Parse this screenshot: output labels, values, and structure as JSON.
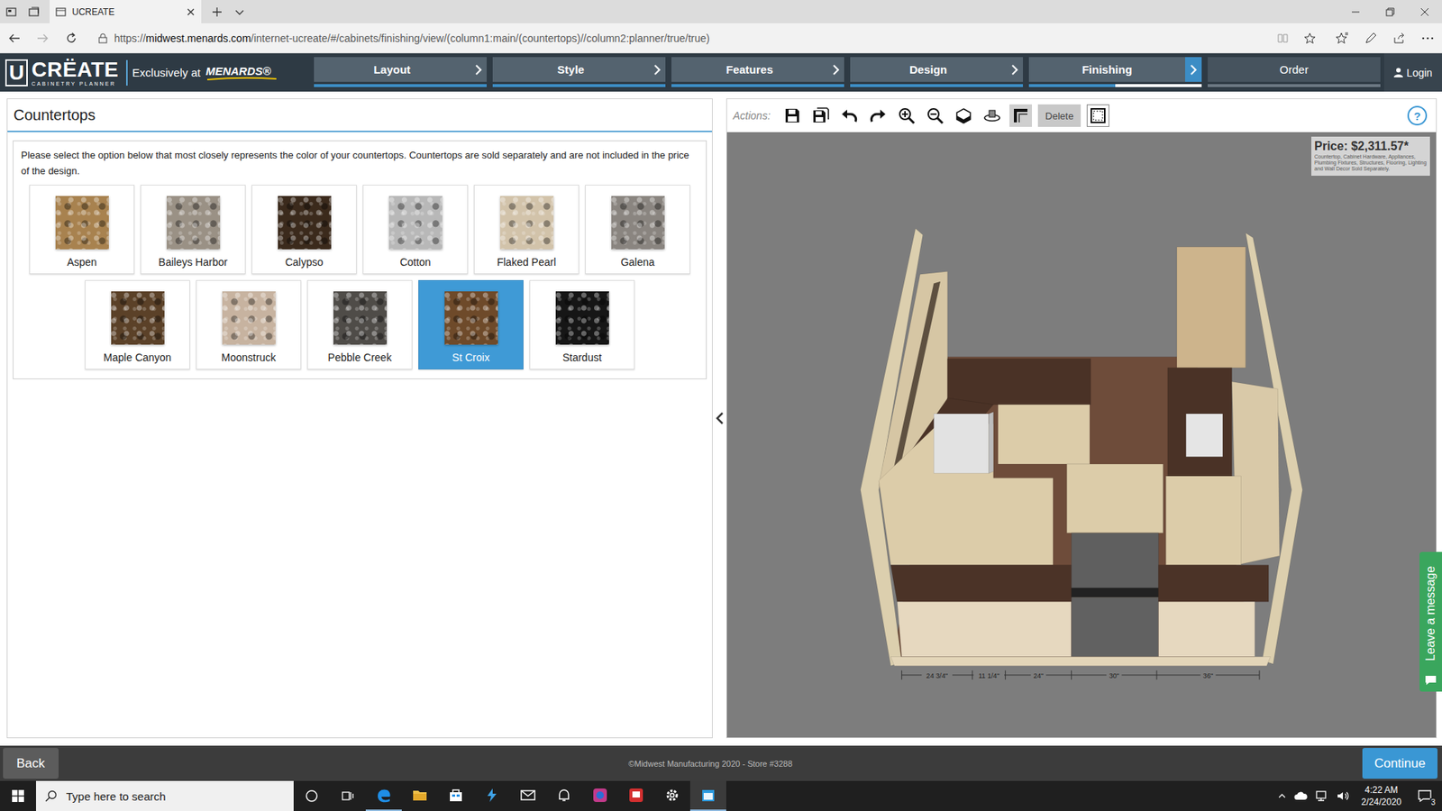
{
  "window": {
    "title": "UCREATE"
  },
  "address_bar": {
    "scheme": "https://",
    "host": "midwest.menards.com",
    "path": "/internet-ucreate/#/cabinets/finishing/view/(column1:main/(countertops)//column2:planner/true/true)",
    "can_go_forward": false
  },
  "app_header": {
    "logo": {
      "mark": "U",
      "name": "CRËATE",
      "tagline": "CABINETRY PLANNER"
    },
    "exclusive": "Exclusively at",
    "brand": "MENARDS®",
    "login": "Login"
  },
  "steps": [
    {
      "label": "Layout",
      "selected": false,
      "arrow": true,
      "level": 1
    },
    {
      "label": "Style",
      "selected": false,
      "arrow": true,
      "level": 1
    },
    {
      "label": "Features",
      "selected": false,
      "arrow": true,
      "level": 1
    },
    {
      "label": "Design",
      "selected": false,
      "arrow": true,
      "level": 1
    },
    {
      "label": "Finishing",
      "selected": true,
      "arrow": true,
      "level": 0.5
    },
    {
      "label": "Order",
      "selected": false,
      "arrow": false,
      "level": 0
    }
  ],
  "panel": {
    "title": "Countertops",
    "description": "Please select the option below that most closely represents the color of your countertops. Countertops are sold separately and are not included in the price of the design."
  },
  "swatches": [
    {
      "name": "Aspen",
      "color": "#a8824f",
      "selected": false
    },
    {
      "name": "Baileys Harbor",
      "color": "#9a9185",
      "selected": false
    },
    {
      "name": "Calypso",
      "color": "#3b2a1c",
      "selected": false
    },
    {
      "name": "Cotton",
      "color": "#b8b8b8",
      "selected": false
    },
    {
      "name": "Flaked Pearl",
      "color": "#d2c3aa",
      "selected": false
    },
    {
      "name": "Galena",
      "color": "#8a8580",
      "selected": false
    },
    {
      "name": "Maple Canyon",
      "color": "#5b4128",
      "selected": false
    },
    {
      "name": "Moonstruck",
      "color": "#c7b3a0",
      "selected": false
    },
    {
      "name": "Pebble Creek",
      "color": "#4f4c48",
      "selected": false
    },
    {
      "name": "St Croix",
      "color": "#6e4a2a",
      "selected": true
    },
    {
      "name": "Stardust",
      "color": "#161616",
      "selected": false
    }
  ],
  "toolbar": {
    "label": "Actions:",
    "delete": {
      "label": "Delete",
      "disabled": true
    },
    "wall_tool_active": true,
    "help": "?"
  },
  "price": {
    "text": "Price: $2,311.57*",
    "note": "Countertop, Cabinet Hardware, Appliances, Plumbing Fixtures, Structures, Flooring, Lighting and Wall Decor Sold Separately."
  },
  "dimensions": [
    "24 3/4\"",
    "11 1/4\"",
    "24\"",
    "30\"",
    "36\""
  ],
  "chat": {
    "label": "Leave a message"
  },
  "footer": {
    "back": "Back",
    "copyright": "©Midwest Manufacturing 2020 - Store #3288",
    "continue": "Continue"
  },
  "taskbar": {
    "search_placeholder": "Type here to search",
    "time": "4:22 AM",
    "date": "2/24/2020",
    "notifications": "3",
    "apps": [
      {
        "kind": "edge",
        "running": true,
        "active": false
      },
      {
        "kind": "explorer",
        "running": false,
        "active": false
      },
      {
        "kind": "store",
        "running": false,
        "active": false
      },
      {
        "kind": "bolt",
        "running": false,
        "active": false
      },
      {
        "kind": "mail",
        "running": false,
        "active": false
      },
      {
        "kind": "bell",
        "running": false,
        "active": false
      },
      {
        "kind": "game",
        "running": false,
        "active": false
      },
      {
        "kind": "red",
        "running": false,
        "active": false
      },
      {
        "kind": "settings",
        "running": false,
        "active": false
      },
      {
        "kind": "calendar",
        "running": true,
        "active": true
      }
    ]
  }
}
